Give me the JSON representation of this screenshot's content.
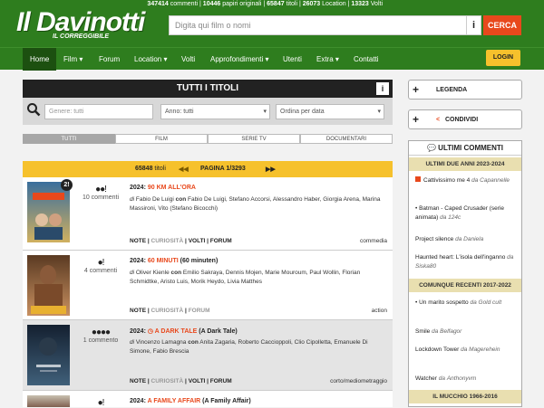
{
  "header": {
    "stats": [
      {
        "num": "347414",
        "label": "commenti"
      },
      {
        "num": "10446",
        "label": "papiri originali"
      },
      {
        "num": "65847",
        "label": "titoli"
      },
      {
        "num": "26073",
        "label": "Location"
      },
      {
        "num": "13323",
        "label": "Volti"
      }
    ],
    "logo_text": "Il Davinotti",
    "logo_sub": "IL CORREGGIBILE",
    "search_placeholder": "Digita qui film o nomi",
    "info_label": "i",
    "search_button": "CERCA"
  },
  "nav": {
    "items": [
      "Home",
      "Film ▾",
      "Forum",
      "Location ▾",
      "Volti",
      "Approfondimenti ▾",
      "Utenti",
      "Extra ▾",
      "Contatti"
    ],
    "login": "LOGIN"
  },
  "filters": {
    "title": "TUTTI I TITOLI",
    "info": "i",
    "genre_placeholder": "Genere: tutti",
    "year_value": "Anno: tutti",
    "order_value": "Ordina per data"
  },
  "tabs": [
    "TUTTI",
    "FILM",
    "SERIE TV",
    "DOCUMENTARI"
  ],
  "pager": {
    "count": "65848",
    "count_label": "titoli",
    "page": "PAGINA 1/3293"
  },
  "films": [
    {
      "badge": "2!",
      "rating": "●●!",
      "comments": "10 commenti",
      "year": "2024:",
      "title": "90 KM ALL'ORA",
      "subtitle": "",
      "director": "Fabio De Luigi",
      "cast": "Fabio De Luigi, Stefano Accorsi, Alessandro Haber, Giorgia Arena, Marina Massironi, Vito (Stefano Bicocchi)",
      "links": [
        "NOTE",
        "CURIOSITÀ",
        "VOLTI",
        "FORUM"
      ],
      "genre": "commedia",
      "poster_colors": [
        "#3a6e9c",
        "#d0b060"
      ]
    },
    {
      "badge": "",
      "rating": "●!",
      "comments": "4 commenti",
      "year": "2024:",
      "title": "60 MINUTI",
      "subtitle": "(60 minuten)",
      "director": "Oliver Kienle",
      "cast": "Emilio Sakraya, Dennis Mojen, Marie Mouroum, Paul Wollin, Florian Schmidtke, Aristo Luis, Morik Heydo, Livia Matthes",
      "links": [
        "NOTE",
        "CURIOSITÀ",
        "FORUM"
      ],
      "genre": "action",
      "poster_colors": [
        "#5a3a22",
        "#c89060"
      ]
    },
    {
      "badge": "",
      "rating": "●●●●",
      "comments": "1 commento",
      "year": "2024:",
      "title": "A DARK TALE",
      "subtitle": "(A Dark Tale)",
      "director": "Vincenzo Lamagna",
      "cast": "Anita Zagaria, Roberto Caccioppoli, Clio Cipolletta, Emanuele Di Simone, Fabio Brescia",
      "links": [
        "NOTE",
        "CURIOSITÀ",
        "VOLTI",
        "FORUM"
      ],
      "genre": "corto/mediometraggio",
      "poster_colors": [
        "#142030",
        "#40607a"
      ]
    },
    {
      "badge": "",
      "rating": "●!",
      "comments": "",
      "year": "2024:",
      "title": "A FAMILY AFFAIR",
      "subtitle": "(A Family Affair)",
      "director": "",
      "cast": "",
      "links": [],
      "genre": "",
      "poster_colors": [
        "#c8c0b0",
        "#806050"
      ]
    }
  ],
  "sidebar": {
    "legenda": "LEGENDA",
    "condividi": "CONDIVIDI",
    "comments_title": "ULTIMI COMMENTI",
    "sections": [
      {
        "title": "ULTIMI DUE ANNI 2023-2024",
        "items": [
          {
            "text": "Cattivissimo me 4",
            "by": "da",
            "user": "Capannelle",
            "flag": true
          },
          {
            "text": "Batman - Caped Crusader (serie animata)",
            "by": "da",
            "user": "124c",
            "flag": false,
            "bullet": "•"
          },
          {
            "text": "Project silence",
            "by": "da",
            "user": "Daniela",
            "flag": false
          },
          {
            "text": "Haunted heart: L'isola dell'inganno",
            "by": "da",
            "user": "Siska80",
            "flag": false
          }
        ]
      },
      {
        "title": "COMUNQUE RECENTI 2017-2022",
        "items": [
          {
            "text": "Un marito sospetto",
            "by": "da",
            "user": "Gold cult",
            "flag": false,
            "bullet": "•"
          },
          {
            "text": "Smile",
            "by": "da",
            "user": "Belfagor",
            "flag": false
          },
          {
            "text": "Lockdown Tower",
            "by": "da",
            "user": "Magerehein",
            "flag": false
          },
          {
            "text": "Watcher",
            "by": "da",
            "user": "Anthonyvm",
            "flag": false
          }
        ]
      },
      {
        "title": "IL MUCCHIO 1966-2016",
        "items": []
      }
    ]
  },
  "colors": {
    "brand_green": "#2e7d1e",
    "accent_orange": "#e8481c",
    "pager_yellow": "#f6c12c"
  }
}
